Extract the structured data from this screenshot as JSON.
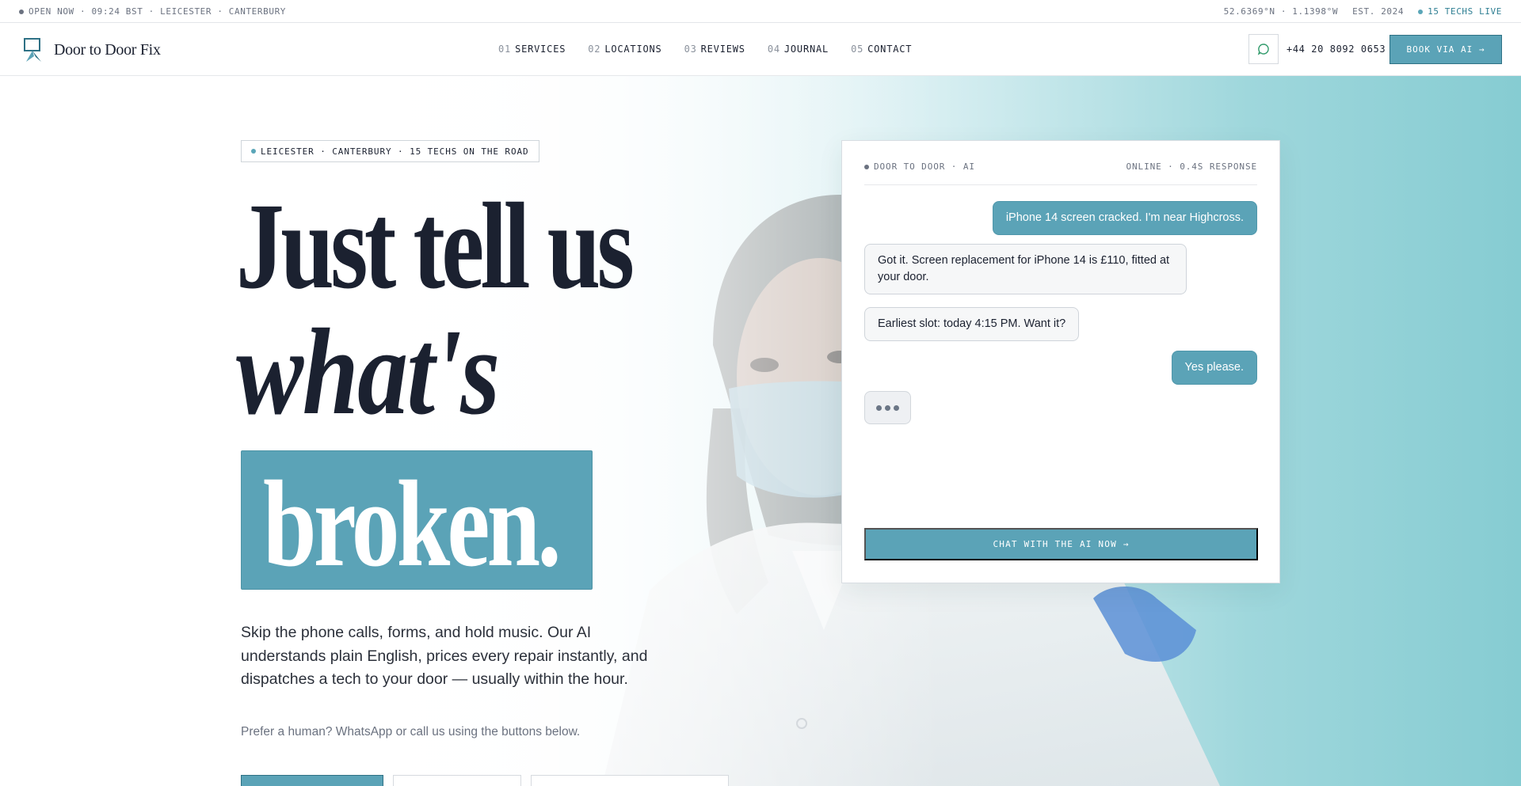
{
  "topbar": {
    "status": "OPEN NOW · 09:24 BST · LEICESTER · CANTERBURY",
    "coords": "52.6369°N · 1.1398°W",
    "established": "EST. 2024",
    "live": "15 TECHS LIVE"
  },
  "brand": {
    "name": "Door to Door Fix"
  },
  "nav": [
    {
      "num": "01",
      "label": "SERVICES"
    },
    {
      "num": "02",
      "label": "LOCATIONS"
    },
    {
      "num": "03",
      "label": "REVIEWS"
    },
    {
      "num": "04",
      "label": "JOURNAL"
    },
    {
      "num": "05",
      "label": "CONTACT"
    }
  ],
  "header": {
    "phone": "+44 20 8092 0653",
    "book_label": "BOOK VIA AI →",
    "whatsapp_icon": "chat-bubble-icon"
  },
  "hero": {
    "eyebrow": "LEICESTER · CANTERBURY · 15 TECHS ON THE ROAD",
    "headline_line1": "Just tell us",
    "headline_line2": "what's",
    "headline_highlight": "broken.",
    "lead": "Skip the phone calls, forms, and hold music. Our AI understands plain English, prices every repair instantly, and dispatches a tech to your door — usually within the hour.",
    "sub": "Prefer a human? WhatsApp or call us using the buttons below."
  },
  "chat": {
    "title": "DOOR TO DOOR · AI",
    "status": "ONLINE · 0.4S RESPONSE",
    "messages": [
      {
        "from": "user",
        "text": "iPhone 14 screen cracked. I'm near Highcross."
      },
      {
        "from": "bot",
        "text": "Got it. Screen replacement for iPhone 14 is £110, fitted at your door."
      },
      {
        "from": "bot",
        "text": "Earliest slot: today 4:15 PM. Want it?"
      },
      {
        "from": "user",
        "text": "Yes please."
      }
    ],
    "cta": "CHAT WITH THE AI NOW →"
  },
  "colors": {
    "accent": "#5ba3b7",
    "ink": "#1b2130",
    "muted": "#6b7280"
  }
}
